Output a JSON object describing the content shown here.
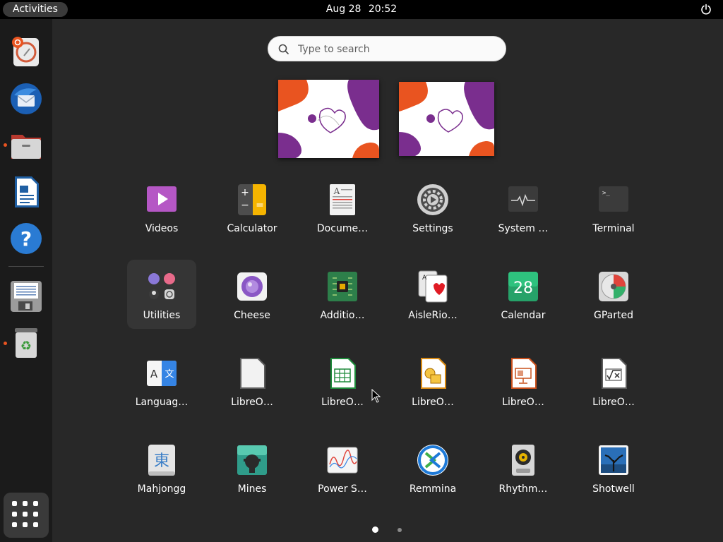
{
  "topbar": {
    "activities": "Activities",
    "date": "Aug 28",
    "time": "20:52",
    "power_icon": "power-icon"
  },
  "dock": {
    "items": [
      {
        "name": "software-updater",
        "icon": "ubuntu-software-icon",
        "running": false
      },
      {
        "name": "thunderbird",
        "icon": "thunderbird-icon",
        "running": false
      },
      {
        "name": "files",
        "icon": "files-icon",
        "running": true
      },
      {
        "name": "libreoffice-writer",
        "icon": "libreoffice-writer-icon",
        "running": false
      },
      {
        "name": "help",
        "icon": "help-icon",
        "running": false
      },
      {
        "name": "install-disk",
        "icon": "disk-icon",
        "running": false
      },
      {
        "name": "trash",
        "icon": "trash-icon",
        "running": true
      }
    ],
    "show_apps_icon": "show-apps-grid-icon"
  },
  "search": {
    "placeholder": "Type to search"
  },
  "apps": [
    {
      "label": "Videos",
      "icon": "videos-icon"
    },
    {
      "label": "Calculator",
      "icon": "calculator-icon"
    },
    {
      "label": "Docume…",
      "icon": "document-viewer-icon"
    },
    {
      "label": "Settings",
      "icon": "settings-icon"
    },
    {
      "label": "System …",
      "icon": "system-monitor-icon"
    },
    {
      "label": "Terminal",
      "icon": "terminal-icon"
    },
    {
      "label": "Utilities",
      "icon": "utilities-folder-icon",
      "selected": true
    },
    {
      "label": "Cheese",
      "icon": "cheese-icon"
    },
    {
      "label": "Additio…",
      "icon": "additional-drivers-icon"
    },
    {
      "label": "AisleRio…",
      "icon": "aisleriot-icon"
    },
    {
      "label": "Calendar",
      "icon": "calendar-icon",
      "badge": "28"
    },
    {
      "label": "GParted",
      "icon": "gparted-icon"
    },
    {
      "label": "Languag…",
      "icon": "language-support-icon"
    },
    {
      "label": "LibreO…",
      "icon": "libreoffice-icon"
    },
    {
      "label": "LibreO…",
      "icon": "libreoffice-calc-icon"
    },
    {
      "label": "LibreO…",
      "icon": "libreoffice-draw-icon"
    },
    {
      "label": "LibreO…",
      "icon": "libreoffice-impress-icon"
    },
    {
      "label": "LibreO…",
      "icon": "libreoffice-math-icon"
    },
    {
      "label": "Mahjongg",
      "icon": "mahjongg-icon",
      "glyph": "東"
    },
    {
      "label": "Mines",
      "icon": "mines-icon"
    },
    {
      "label": "Power S…",
      "icon": "power-statistics-icon"
    },
    {
      "label": "Remmina",
      "icon": "remmina-icon"
    },
    {
      "label": "Rhythm…",
      "icon": "rhythmbox-icon"
    },
    {
      "label": "Shotwell",
      "icon": "shotwell-icon"
    }
  ],
  "pager": {
    "pages": 2,
    "current": 1
  },
  "colors": {
    "accent": "#e95420",
    "purple": "#7a2e8e",
    "bg": "#282828"
  }
}
